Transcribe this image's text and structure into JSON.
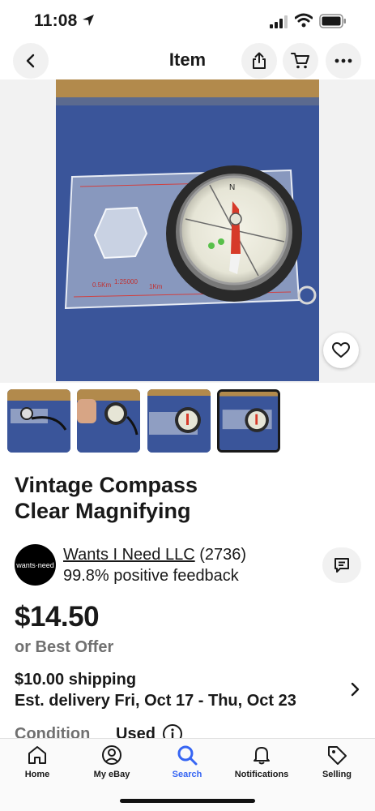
{
  "status_bar": {
    "time": "11:08"
  },
  "nav": {
    "title": "Item"
  },
  "listing": {
    "title_line1": "Vintage Compass",
    "title_line2": "Clear Magnifying",
    "price": "$14.50",
    "best_offer": "or Best Offer",
    "shipping_cost": "$10.00 shipping",
    "delivery": "Est. delivery Fri, Oct 17 - Thu, Oct 23",
    "condition_label": "Condition",
    "condition_value": "Used"
  },
  "seller": {
    "name": "Wants I Need LLC",
    "feedback_count": "(2736)",
    "feedback": "99.8% positive feedback",
    "avatar_text": "wants·need"
  },
  "gallery": {
    "thumb_count": 4,
    "selected_index": 3
  },
  "tab_bar": {
    "items": [
      {
        "label": "Home",
        "icon": "home-icon"
      },
      {
        "label": "My eBay",
        "icon": "profile-icon"
      },
      {
        "label": "Search",
        "icon": "search-icon",
        "active": true
      },
      {
        "label": "Notifications",
        "icon": "bell-icon"
      },
      {
        "label": "Selling",
        "icon": "tag-icon"
      }
    ]
  },
  "colors": {
    "accent": "#3665f3",
    "text": "#191919",
    "muted": "#707070"
  }
}
